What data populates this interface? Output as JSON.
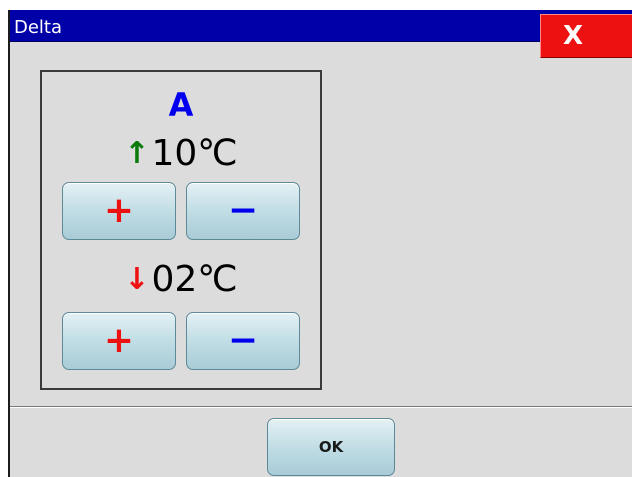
{
  "window": {
    "title": "Delta",
    "close_glyph": "X"
  },
  "panel": {
    "label": "A",
    "upper": {
      "arrow": "↑",
      "value": "10℃",
      "plus_glyph": "+",
      "minus_glyph": "−"
    },
    "lower": {
      "arrow": "↓",
      "value": "02℃",
      "plus_glyph": "+",
      "minus_glyph": "−"
    }
  },
  "footer": {
    "ok_label": "OK"
  },
  "colors": {
    "title_bar": "#0000a8",
    "close_button": "#ee1111",
    "label": "#0000ee",
    "arrow_up": "#0a7a0a",
    "arrow_down": "#ee1111",
    "plus": "#ee1111",
    "minus": "#0000ee",
    "button_face": "#c1dde5",
    "window_background": "#dcdcdc"
  },
  "icons": {
    "close": "close-icon",
    "arrow_up": "arrow-up-icon",
    "arrow_down": "arrow-down-icon",
    "plus": "plus-icon",
    "minus": "minus-icon"
  }
}
